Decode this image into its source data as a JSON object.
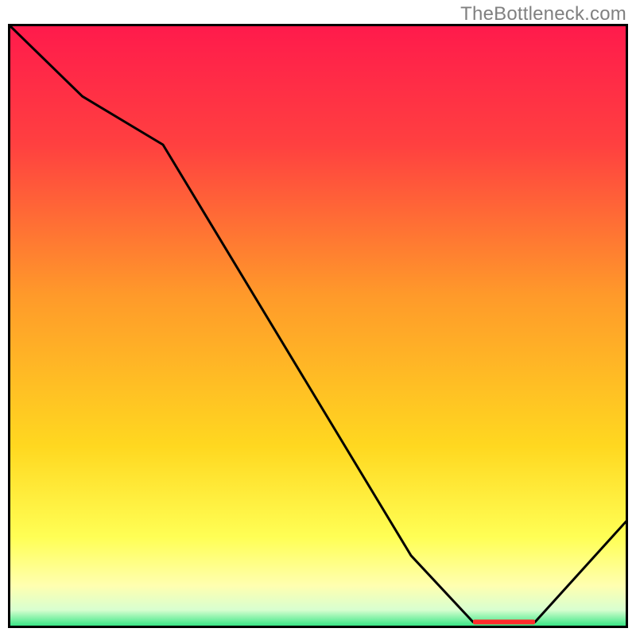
{
  "watermark": "TheBottleneck.com",
  "chart_data": {
    "type": "line",
    "title": "",
    "xlabel": "",
    "ylabel": "",
    "xlim": [
      0,
      100
    ],
    "ylim": [
      0,
      100
    ],
    "grid": false,
    "series": [
      {
        "name": "curve",
        "x": [
          0,
          12,
          25,
          65,
          75,
          85,
          100
        ],
        "values": [
          100,
          88,
          80,
          12,
          1,
          1,
          18
        ]
      }
    ],
    "markers": [
      {
        "name": "optimum-band",
        "x_range": [
          75,
          85
        ],
        "y": 1
      }
    ],
    "gradient_stops": [
      {
        "offset": 0.0,
        "color": "#ff1a4c"
      },
      {
        "offset": 0.2,
        "color": "#ff4040"
      },
      {
        "offset": 0.45,
        "color": "#ff9a2a"
      },
      {
        "offset": 0.7,
        "color": "#ffd820"
      },
      {
        "offset": 0.85,
        "color": "#ffff55"
      },
      {
        "offset": 0.93,
        "color": "#ffffb0"
      },
      {
        "offset": 0.97,
        "color": "#d8ffd0"
      },
      {
        "offset": 1.0,
        "color": "#22e27a"
      }
    ]
  }
}
